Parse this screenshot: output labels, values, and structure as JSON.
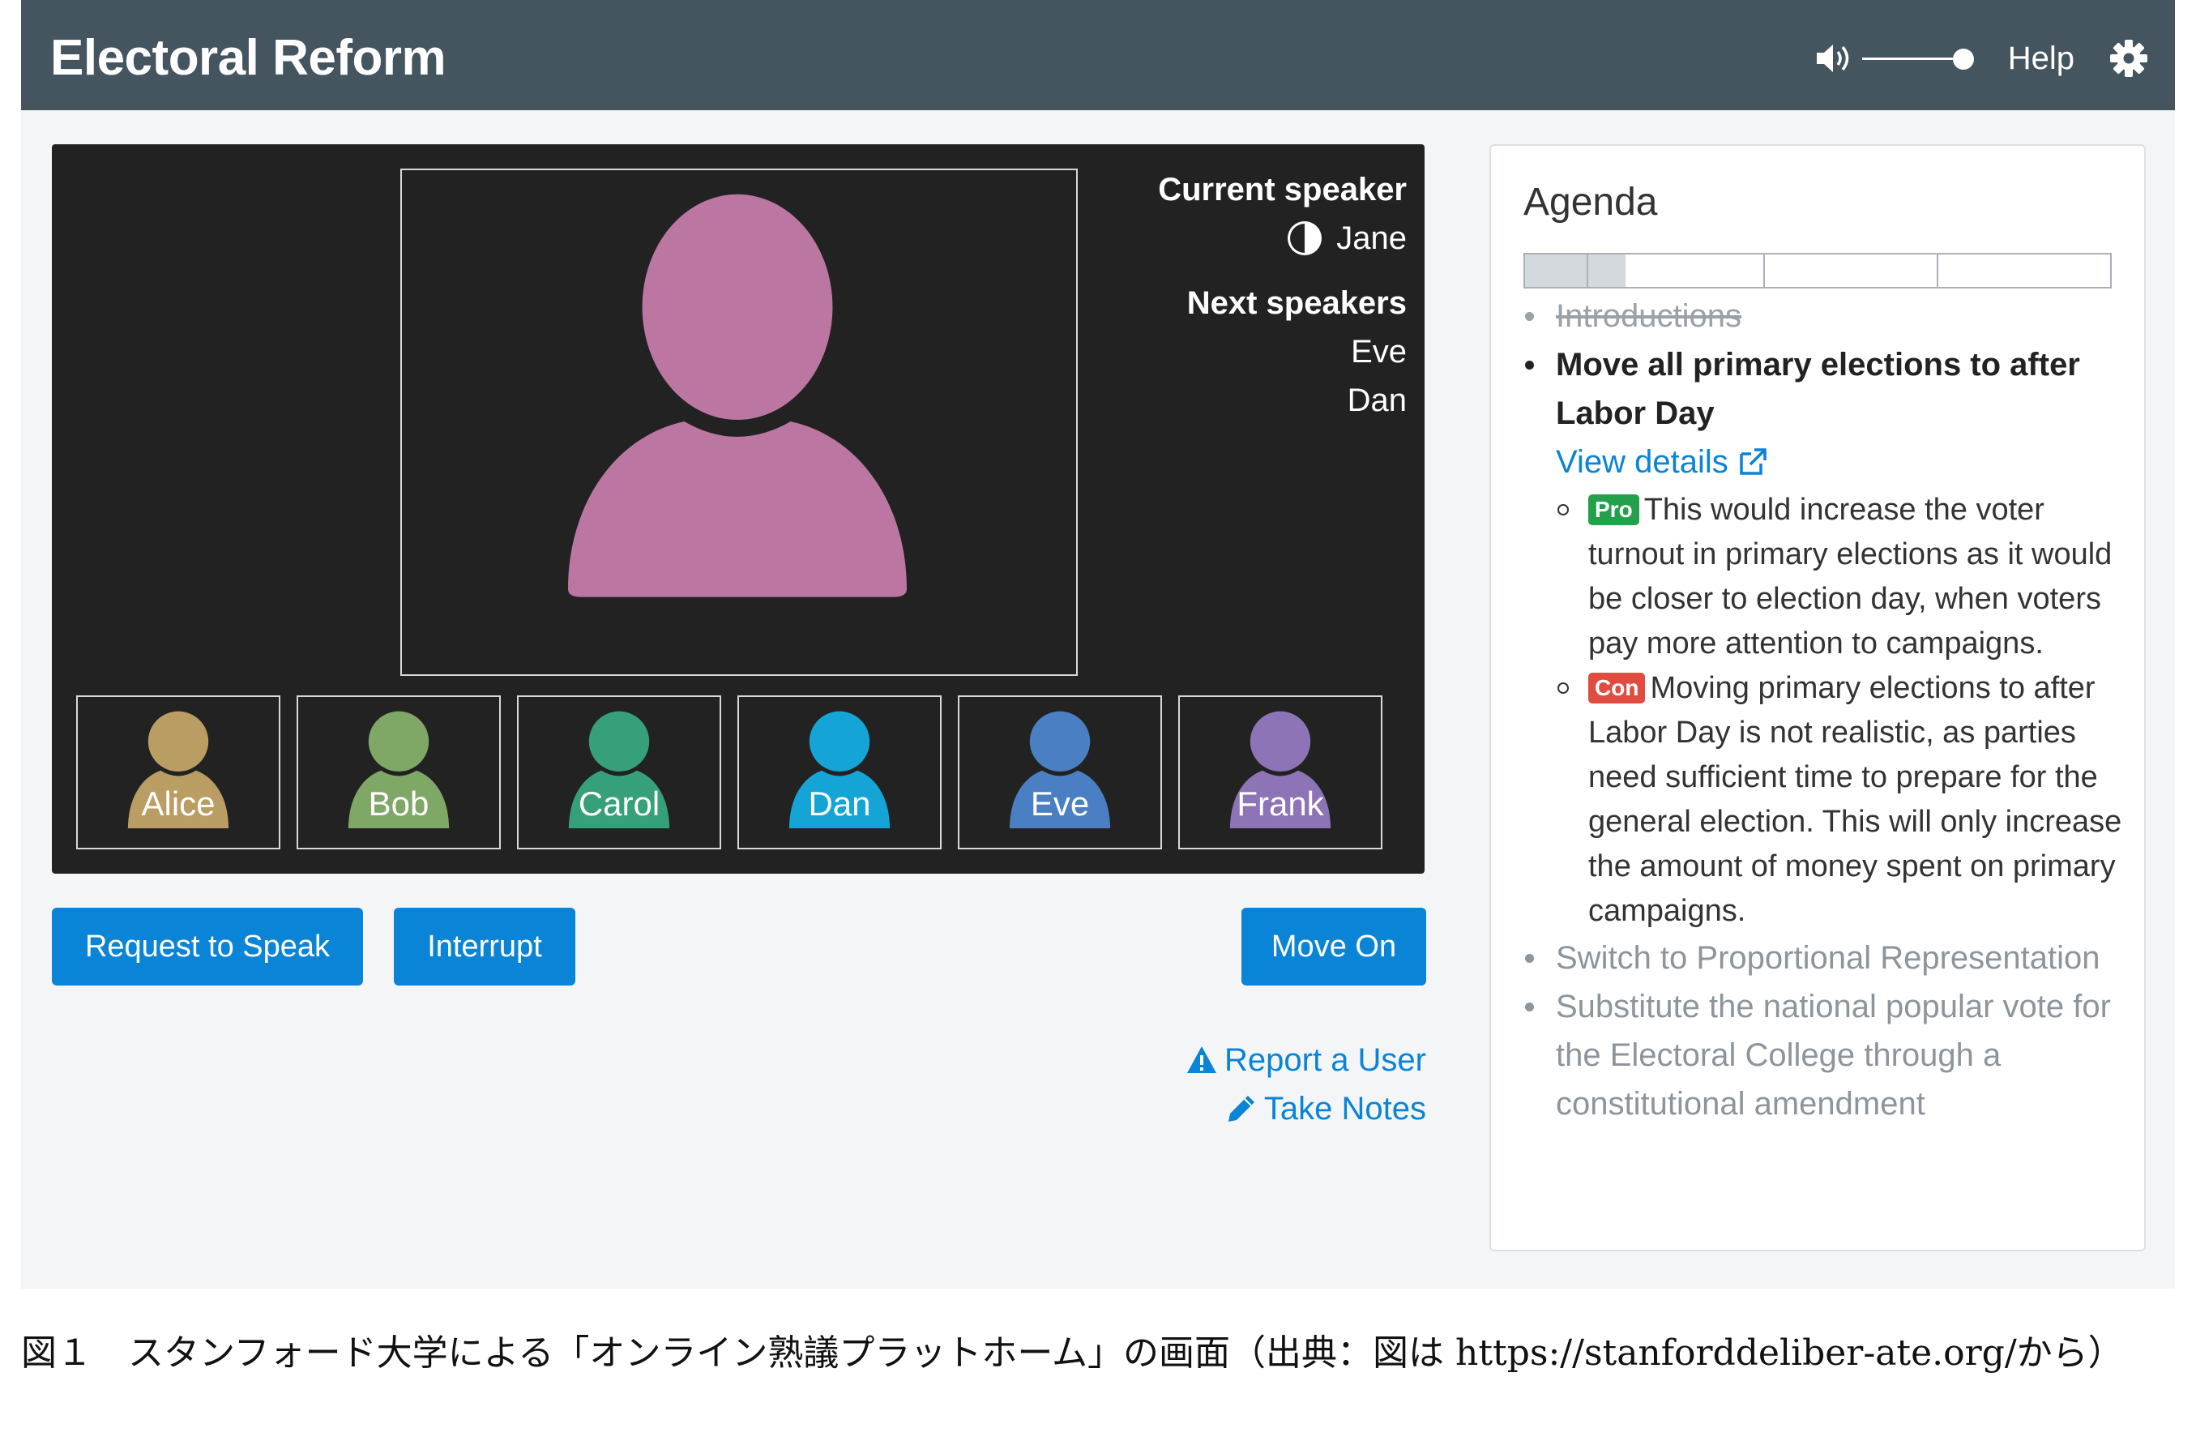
{
  "app": {
    "title": "Electoral Reform",
    "help_label": "Help",
    "volume_level_pct": 100
  },
  "video": {
    "main_avatar_color": "#bc76a2",
    "current_speaker_label": "Current speaker",
    "current_speaker": "Jane",
    "next_speakers_label": "Next speakers",
    "next_speakers": [
      "Eve",
      "Dan"
    ],
    "participants": [
      {
        "name": "Alice",
        "color": "#b99d63"
      },
      {
        "name": "Bob",
        "color": "#7fa765"
      },
      {
        "name": "Carol",
        "color": "#35a07a"
      },
      {
        "name": "Dan",
        "color": "#14a5d6"
      },
      {
        "name": "Eve",
        "color": "#4a7fc3"
      },
      {
        "name": "Frank",
        "color": "#8c74b6"
      }
    ]
  },
  "actions": {
    "request_label": "Request to Speak",
    "interrupt_label": "Interrupt",
    "move_on_label": "Move On",
    "report_label": "Report a User",
    "notes_label": "Take Notes"
  },
  "agenda": {
    "title": "Agenda",
    "items": [
      {
        "text": "Introductions",
        "status": "done"
      },
      {
        "text": "Move all primary elections to after Labor Day",
        "status": "current",
        "link": "View details"
      },
      {
        "text": "Switch to Proportional Representation",
        "status": "future"
      },
      {
        "text": "Substitute the national popular vote for the Electoral College through a constitutional amendment",
        "status": "future"
      }
    ],
    "arguments": [
      {
        "badge": "Pro",
        "text": "This would increase the voter turnout in primary elections as it would be closer to election day, when voters pay more attention to campaigns."
      },
      {
        "badge": "Con",
        "text": "Moving primary elections to after Labor Day is not realistic, as parties need sufficient time to prepare for the general election. This will only increase the amount of money spent on primary campaigns."
      }
    ]
  },
  "caption": "図１　スタンフォード大学による「オンライン熟議プラットホーム」の画面（出典：図は https://stanforddeliber-ate.org/から）",
  "colors": {
    "topbar": "#45555f",
    "accent": "#0a84d6",
    "pro": "#22a04a",
    "con": "#e04c3f"
  }
}
